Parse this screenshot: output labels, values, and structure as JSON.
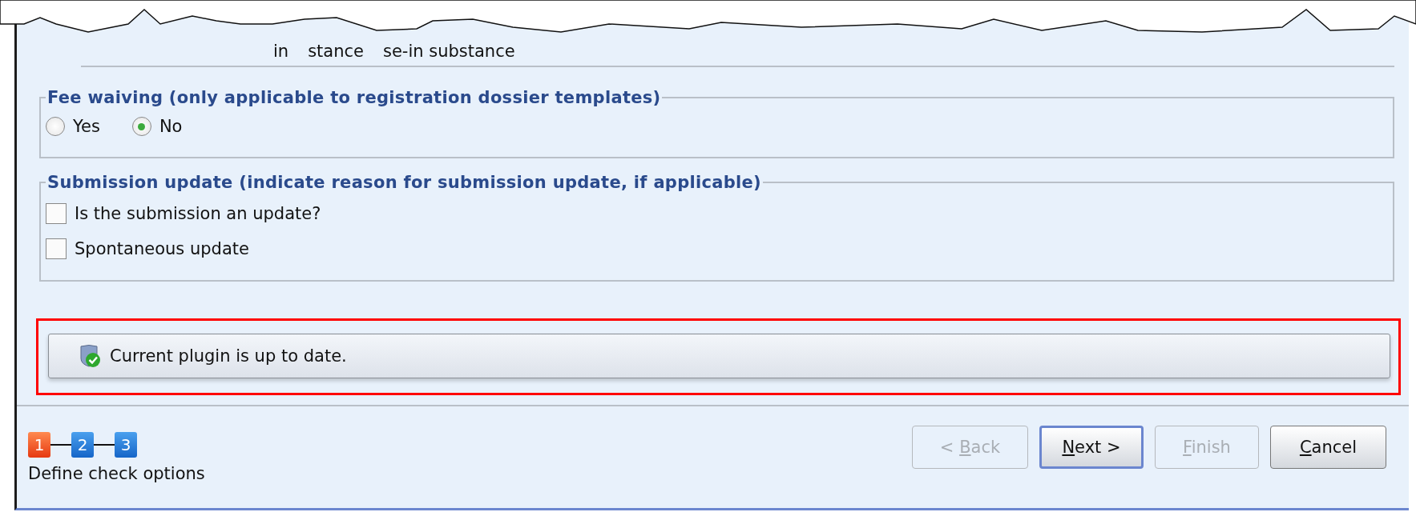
{
  "torn_fragments": [
    "in",
    "stance",
    "se-in substance"
  ],
  "fee_waiving": {
    "title": "Fee waiving (only applicable to registration dossier templates)",
    "options": [
      {
        "label": "Yes",
        "selected": false
      },
      {
        "label": "No",
        "selected": true
      }
    ]
  },
  "submission_update": {
    "title": "Submission update (indicate reason for submission update, if applicable)",
    "checkboxes": [
      {
        "label": "Is the submission an update?",
        "checked": false
      },
      {
        "label": "Spontaneous update",
        "checked": false
      }
    ]
  },
  "plugin_status": {
    "message": "Current plugin is up to date.",
    "highlighted": true
  },
  "steps": [
    {
      "label": "1",
      "selected": true
    },
    {
      "label": "2",
      "selected": false
    },
    {
      "label": "3",
      "selected": false
    }
  ],
  "step_caption": "Define check options",
  "buttons": [
    {
      "before": "< ",
      "mnemonic": "B",
      "after": "ack",
      "disabled": true,
      "default": false
    },
    {
      "mnemonic": "N",
      "after": "ext >",
      "disabled": false,
      "default": true
    },
    {
      "mnemonic": "F",
      "after": "inish",
      "disabled": true,
      "default": false
    },
    {
      "mnemonic": "C",
      "after": "ancel",
      "disabled": false,
      "default": false
    }
  ]
}
